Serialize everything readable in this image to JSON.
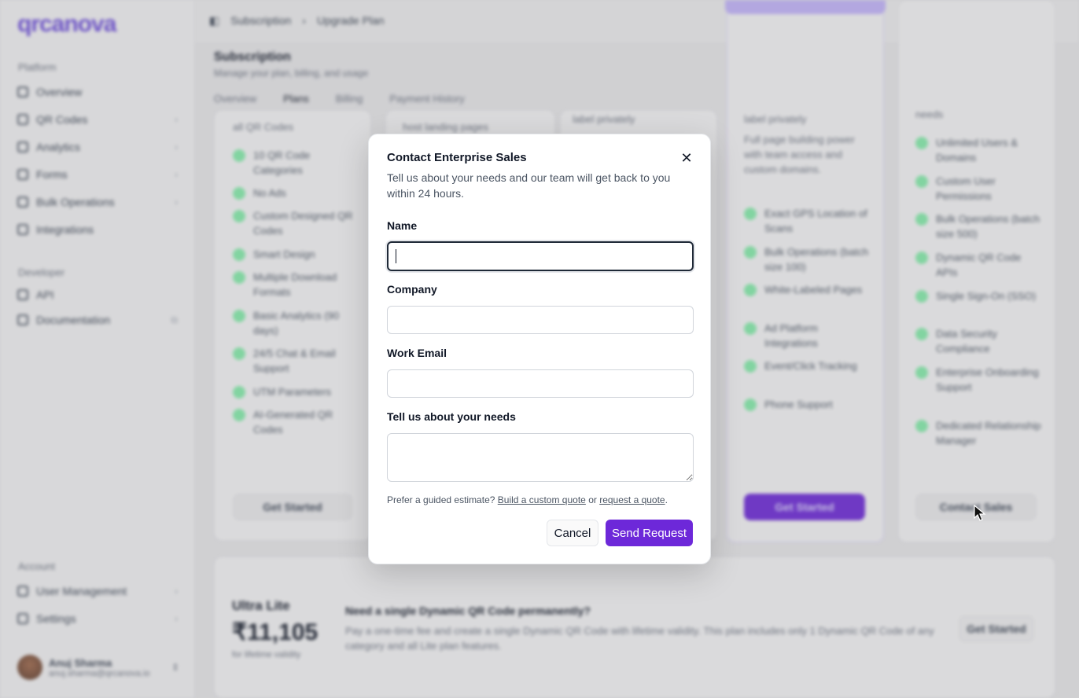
{
  "app": {
    "logo": "qrcanova"
  },
  "sidebar": {
    "sections": [
      {
        "title": "Platform"
      },
      {
        "title": "Developer"
      },
      {
        "title": "Account"
      }
    ],
    "platform_items": [
      {
        "label": "Overview",
        "icon": "dashboard-icon",
        "chevron": ""
      },
      {
        "label": "QR Codes",
        "icon": "qr-code-icon",
        "chevron": "›"
      },
      {
        "label": "Analytics",
        "icon": "chart-icon",
        "chevron": "›"
      },
      {
        "label": "Forms",
        "icon": "form-icon",
        "chevron": "›"
      },
      {
        "label": "Bulk Operations",
        "icon": "layers-icon",
        "chevron": "›"
      },
      {
        "label": "Integrations",
        "icon": "plug-icon",
        "chevron": ""
      }
    ],
    "developer_items": [
      {
        "label": "API",
        "icon": "code-icon",
        "chevron": ""
      },
      {
        "label": "Documentation",
        "icon": "book-icon",
        "chevron": ""
      }
    ],
    "account_items": [
      {
        "label": "User Management",
        "icon": "users-icon",
        "chevron": "›"
      },
      {
        "label": "Settings",
        "icon": "gear-icon",
        "chevron": "›"
      }
    ],
    "user": {
      "name": "Anuj Sharma",
      "email": "anuj.sharma@qrcanova.io"
    }
  },
  "header": {
    "breadcrumb": [
      "Subscription",
      "Upgrade Plan"
    ],
    "title": "Subscription",
    "subtitle": "Manage your plan, billing, and usage",
    "tabs": [
      "Overview",
      "Plans",
      "Billing",
      "Payment History"
    ],
    "active_tab": "Plans"
  },
  "plans": {
    "card1": {
      "top_text": "all QR Codes",
      "features": [
        "10 QR Code Categories",
        "No Ads",
        "Custom Designed QR Codes",
        "Smart Design",
        "Multiple Download Formats",
        "Basic Analytics (90 days)",
        "24/5 Chat & Email Support",
        "UTM Parameters",
        "AI-Generated QR Codes"
      ],
      "button": "Get Started"
    },
    "card2": {
      "top_text": "host landing pages"
    },
    "card3": {
      "top_text": "label privately"
    },
    "card4": {
      "top_text": "label privately",
      "desc": "Full page building power with team access and custom domains.",
      "features": [
        "Exact GPS Location of Scans",
        "Bulk Operations (batch size 100)",
        "White-Labeled Pages",
        "Ad Platform Integrations",
        "Event/Click Tracking",
        "Phone Support"
      ],
      "button": "Get Started"
    },
    "card5": {
      "top_text": "needs",
      "features": [
        "Unlimited Users & Domains",
        "Custom User Permissions",
        "Bulk Operations (batch size 500)",
        "Dynamic QR Code APIs",
        "Single Sign-On (SSO)",
        "Data Security Compliance",
        "Enterprise Onboarding Support",
        "Dedicated Relationship Manager"
      ],
      "button": "Contact Sales"
    }
  },
  "ultra": {
    "name": "Ultra Lite",
    "price": "₹11,105",
    "note": "for lifetime validity",
    "heading": "Need a single Dynamic QR Code permanently?",
    "desc": "Pay a one-time fee and create a single Dynamic QR Code with lifetime validity. This plan includes only 1 Dynamic QR Code of any category and all Lite plan features.",
    "button": "Get Started"
  },
  "modal": {
    "title": "Contact Enterprise Sales",
    "description": "Tell us about your needs and our team will get back to you within 24 hours.",
    "close_icon": "close-icon",
    "fields": {
      "name": {
        "label": "Name",
        "value": "",
        "placeholder": ""
      },
      "company": {
        "label": "Company",
        "value": "",
        "placeholder": ""
      },
      "email": {
        "label": "Work Email",
        "value": "",
        "placeholder": ""
      },
      "needs": {
        "label": "Tell us about your needs",
        "value": "",
        "placeholder": ""
      }
    },
    "hint": {
      "prefix": "Prefer a guided estimate?",
      "link1": "Build a custom quote",
      "middle": "or",
      "link2": "request a quote",
      "suffix": "."
    },
    "cancel_label": "Cancel",
    "send_label": "Send Request"
  },
  "colors": {
    "accent": "#6d28d9",
    "logo": "#6d4ddc",
    "success": "#86efac"
  }
}
